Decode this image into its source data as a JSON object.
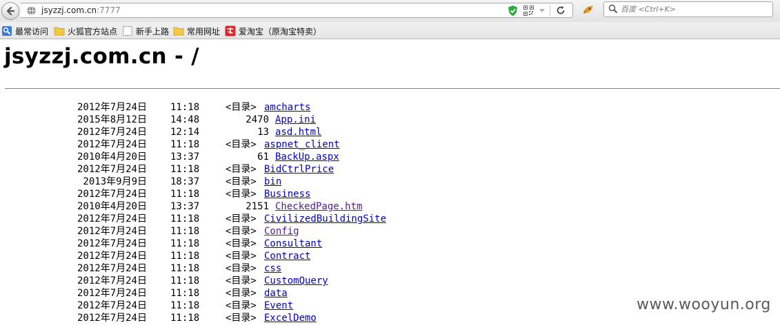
{
  "browser": {
    "url_host": "jsyzzj.com.cn",
    "url_port": ":7777",
    "search_placeholder": "百度 <Ctrl+K>"
  },
  "bookmarks": [
    {
      "label": "最常访问",
      "icon": "most-visited-icon"
    },
    {
      "label": "火狐官方站点",
      "icon": "folder-icon"
    },
    {
      "label": "新手上路",
      "icon": "page-icon"
    },
    {
      "label": "常用网址",
      "icon": "folder-icon"
    },
    {
      "label": "爱淘宝（原淘宝特卖）",
      "icon": "taobao-icon"
    }
  ],
  "page": {
    "title": "jsyzzj.com.cn - /",
    "dir_tag": "<目录>",
    "watermark": "www.wooyun.org",
    "entries": [
      {
        "date": "2012年7月24日",
        "time": "11:18",
        "type": "dir",
        "size": "",
        "name": "amcharts",
        "visited": false
      },
      {
        "date": "2015年8月12日",
        "time": "14:48",
        "type": "file",
        "size": "2470",
        "name": "App.ini",
        "visited": false
      },
      {
        "date": "2012年7月24日",
        "time": "12:14",
        "type": "file",
        "size": "13",
        "name": "asd.html",
        "visited": false
      },
      {
        "date": "2012年7月24日",
        "time": "11:18",
        "type": "dir",
        "size": "",
        "name": "aspnet_client",
        "visited": false
      },
      {
        "date": "2010年4月20日",
        "time": "13:37",
        "type": "file",
        "size": "61",
        "name": "BackUp.aspx",
        "visited": false
      },
      {
        "date": "2012年7月24日",
        "time": "11:18",
        "type": "dir",
        "size": "",
        "name": "BidCtrlPrice",
        "visited": false
      },
      {
        "date": "2013年9月9日",
        "time": "18:37",
        "type": "dir",
        "size": "",
        "name": "bin",
        "visited": false
      },
      {
        "date": "2012年7月24日",
        "time": "11:18",
        "type": "dir",
        "size": "",
        "name": "Business",
        "visited": false
      },
      {
        "date": "2010年4月20日",
        "time": "13:37",
        "type": "file",
        "size": "2151",
        "name": "CheckedPage.htm",
        "visited": true
      },
      {
        "date": "2012年7月24日",
        "time": "11:18",
        "type": "dir",
        "size": "",
        "name": "CivilizedBuildingSite",
        "visited": false
      },
      {
        "date": "2012年7月24日",
        "time": "11:18",
        "type": "dir",
        "size": "",
        "name": "Config",
        "visited": true
      },
      {
        "date": "2012年7月24日",
        "time": "11:18",
        "type": "dir",
        "size": "",
        "name": "Consultant",
        "visited": false
      },
      {
        "date": "2012年7月24日",
        "time": "11:18",
        "type": "dir",
        "size": "",
        "name": "Contract",
        "visited": false
      },
      {
        "date": "2012年7月24日",
        "time": "11:18",
        "type": "dir",
        "size": "",
        "name": "css",
        "visited": false
      },
      {
        "date": "2012年7月24日",
        "time": "11:18",
        "type": "dir",
        "size": "",
        "name": "CustomQuery",
        "visited": false
      },
      {
        "date": "2012年7月24日",
        "time": "11:18",
        "type": "dir",
        "size": "",
        "name": "data",
        "visited": false
      },
      {
        "date": "2012年7月24日",
        "time": "11:18",
        "type": "dir",
        "size": "",
        "name": "Event",
        "visited": false
      },
      {
        "date": "2012年7月24日",
        "time": "11:18",
        "type": "dir",
        "size": "",
        "name": "ExcelDemo",
        "visited": false
      }
    ]
  }
}
